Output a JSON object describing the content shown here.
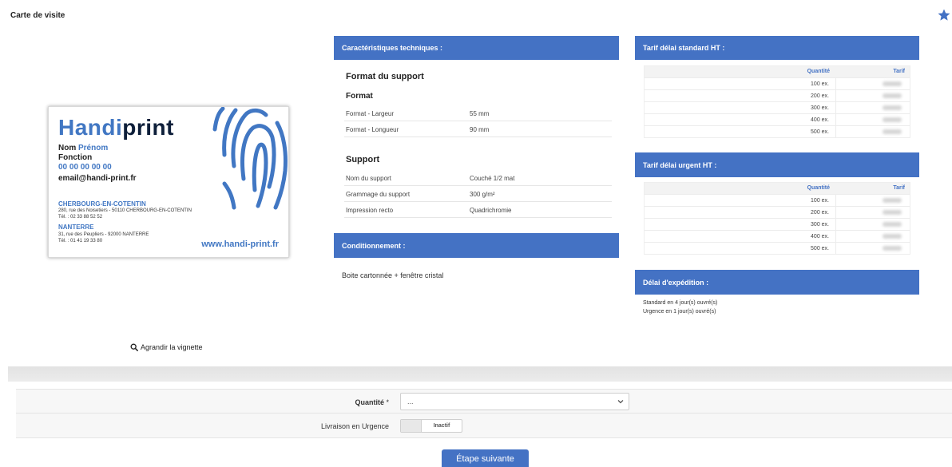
{
  "page": {
    "title": "Carte de visite"
  },
  "card": {
    "logo_part1": "Handi",
    "logo_part2": "print",
    "name_last": "Nom ",
    "name_first": "Prénom",
    "function": "Fonction",
    "phone": "00 00 00 00 00",
    "email": "email@handi-print.fr",
    "city1": "CHERBOURG-EN-COTENTIN",
    "address1": "280, rue des Noisetiers - 50110 CHERBOURG-EN-COTENTIN",
    "tel1": "Tél. : 02 33 88 52 52",
    "city2": "NANTERRE",
    "address2": "31, rue des Peupliers - 92000 NANTERRE",
    "tel2": "Tél. : 01 41 19 33 80",
    "website": "www.handi-print.fr",
    "brand_blue": "#4177c3",
    "brand_dark": "#0e1f3a"
  },
  "enlarge": {
    "label": "Agrandir la vignette",
    "icon": "magnifier-icon"
  },
  "tech": {
    "header": "Caractéristiques techniques :",
    "format_section": "Format du support",
    "format_sub": "Format",
    "format_rows": [
      {
        "label": "Format - Largeur",
        "value": "55 mm"
      },
      {
        "label": "Format - Longueur",
        "value": "90 mm"
      }
    ],
    "support_section": "Support",
    "support_rows": [
      {
        "label": "Nom du support",
        "value": "Couché 1/2 mat"
      },
      {
        "label": "Grammage du support",
        "value": "300 g/m²"
      },
      {
        "label": "Impression recto",
        "value": "Quadrichromie"
      }
    ]
  },
  "conditioning": {
    "header": "Conditionnement :",
    "text": "Boite cartonnée + fenêtre cristal"
  },
  "standard_price": {
    "header": "Tarif délai standard HT :",
    "col_qty": "Quantité",
    "col_price": "Tarif",
    "rows": [
      "100 ex.",
      "200 ex.",
      "300 ex.",
      "400 ex.",
      "500 ex."
    ]
  },
  "urgent_price": {
    "header": "Tarif délai urgent HT :",
    "col_qty": "Quantité",
    "col_price": "Tarif",
    "rows": [
      "100 ex.",
      "200 ex.",
      "300 ex.",
      "400 ex.",
      "500 ex."
    ]
  },
  "shipping": {
    "header": "Délai d'expédition :",
    "standard": "Standard en 4 jour(s) ouvré(s)",
    "urgent": "Urgence en 1 jour(s) ouvré(s)"
  },
  "form": {
    "qty_label": "Quantité",
    "qty_required": " *",
    "qty_value": "...",
    "urgent_label": "Livraison en Urgence",
    "urgent_state": "Inactif"
  },
  "next_button": "Étape suivante",
  "accent_color": "#4472c4"
}
